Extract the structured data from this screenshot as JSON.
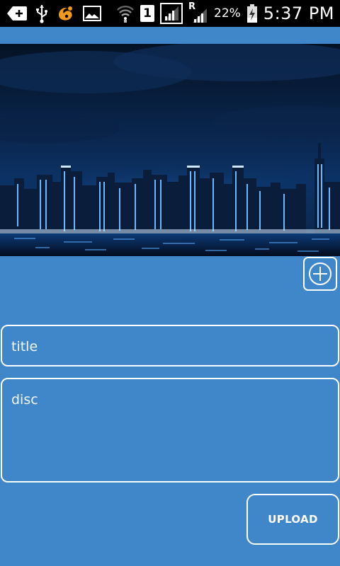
{
  "status_bar": {
    "time": "5:37 PM",
    "battery_percent": "22%",
    "sim_slot": "1",
    "roaming_marker": "R",
    "icons": [
      "add-notification-icon",
      "usb-icon",
      "uc-browser-icon",
      "image-icon",
      "wifi-icon",
      "sim-icon",
      "signal-icon",
      "roaming-signal-icon",
      "battery-charging-icon"
    ]
  },
  "hero_image": {
    "description_icon": "city-night-skyline-image"
  },
  "add_button": {
    "icon": "add-circle-icon"
  },
  "form": {
    "title_placeholder": "title",
    "disc_placeholder": "disc",
    "upload_label": "UPLOAD"
  },
  "colors": {
    "background": "#3f87c9",
    "status_bar": "#000000",
    "border": "#ffffff"
  }
}
